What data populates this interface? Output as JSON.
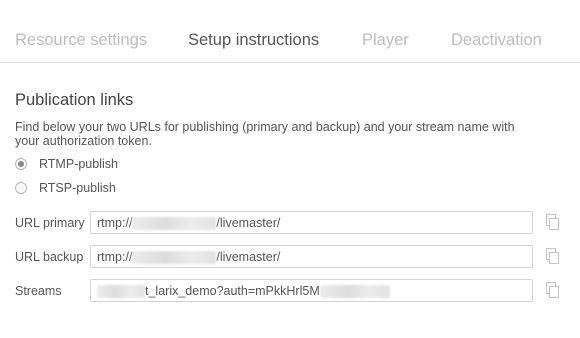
{
  "tabs": [
    {
      "label": "Resource settings",
      "active": false
    },
    {
      "label": "Setup instructions",
      "active": true
    },
    {
      "label": "Player",
      "active": false
    },
    {
      "label": "Deactivation",
      "active": false
    }
  ],
  "section": {
    "title": "Publication links",
    "description": "Find below your two URLs for publishing (primary and backup) and your stream name with your authorization token."
  },
  "protocols": [
    {
      "label": "RTMP-publish",
      "checked": true
    },
    {
      "label": "RTSP-publish",
      "checked": false
    }
  ],
  "fields": {
    "primary": {
      "label": "URL primary",
      "prefix": "rtmp://",
      "suffix": "/livemaster/"
    },
    "backup": {
      "label": "URL backup",
      "prefix": "rtmp://",
      "suffix": "/livemaster/"
    },
    "streams": {
      "label": "Streams",
      "prefix": "",
      "value": "t_larix_demo?auth=mPkkHrl5M"
    }
  },
  "icons": {
    "copy": "copy-icon"
  },
  "colors": {
    "active_tab": "#555555",
    "inactive_tab": "#bdbdbd",
    "border": "#d4d4d4"
  }
}
